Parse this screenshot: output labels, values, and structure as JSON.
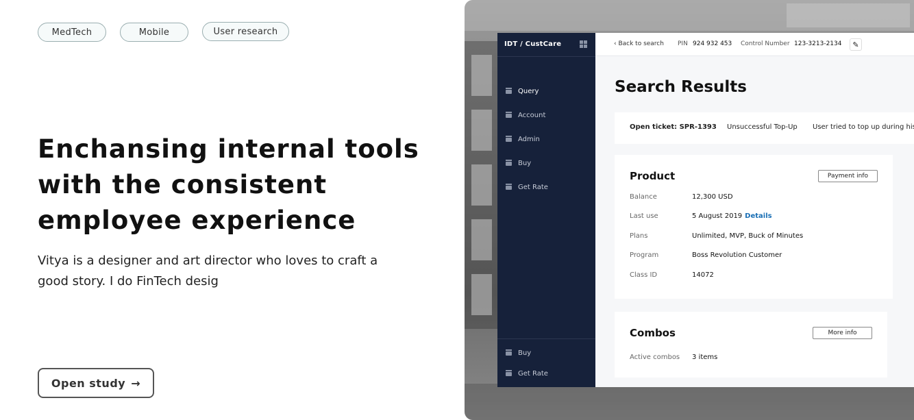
{
  "tags": [
    "MedTech",
    "Mobile",
    "User research"
  ],
  "headline_lines": [
    "Enchansing internal tools",
    "with the consistent",
    "employee experience"
  ],
  "intro_lines": [
    "Vitya is a designer and art director who loves to craft a",
    "good story. I do FinTech desig"
  ],
  "open_button": {
    "label": "Open study",
    "arrow": "→"
  },
  "app": {
    "brand": "IDT / CustCare",
    "nav": [
      "Query",
      "Account",
      "Admin",
      "Buy",
      "Get Rate"
    ],
    "nav_bottom": [
      "Buy",
      "Get Rate"
    ],
    "topbar": {
      "back": "‹ Back to search",
      "pin_label": "PIN",
      "pin_value": "924 932 453",
      "control_label": "Control Number",
      "control_value": "123-3213-2134",
      "edit_icon": "✎"
    },
    "title": "Search Results",
    "ticket": {
      "id": "Open ticket: SPR-1393",
      "reason": "Unsuccessful Top-Up",
      "note": "User tried to top up during his"
    },
    "product": {
      "title": "Product",
      "button": "Payment info",
      "rows": [
        {
          "key": "Balance",
          "value": "12,300 USD"
        },
        {
          "key": "Last use",
          "value": "5 August 2019",
          "link": "Details"
        },
        {
          "key": "Plans",
          "value": "Unlimited, MVP, Buck of Minutes"
        },
        {
          "key": "Program",
          "value": "Boss Revolution Customer"
        },
        {
          "key": "Class ID",
          "value": "14072"
        }
      ]
    },
    "combos": {
      "title": "Combos",
      "button": "More info",
      "rows": [
        {
          "key": "Active combos",
          "value": "3 items"
        }
      ]
    }
  }
}
